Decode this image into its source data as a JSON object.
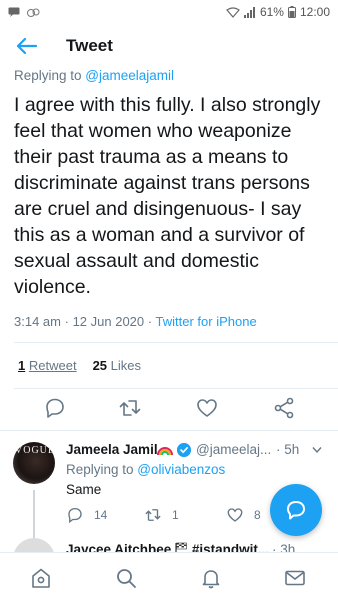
{
  "status": {
    "battery": "61%",
    "time": "12:00"
  },
  "header": {
    "title": "Tweet"
  },
  "tweet": {
    "replying_prefix": "Replying to ",
    "replying_handle": "@jameelajamil",
    "text": "I agree with this fully. I also strongly feel that women who weaponize their past trauma as a means to discriminate against trans persons are cruel and disingenuous- I say this as a woman and a survivor of sexual assault and domestic violence.",
    "time": "3:14 am",
    "date": "12 Jun 2020",
    "separator": "·",
    "source": "Twitter for iPhone",
    "retweets_count": "1",
    "retweets_label": "Retweet",
    "likes_count": "25",
    "likes_label": "Likes"
  },
  "actions": [
    "reply-icon",
    "retweet-icon",
    "like-icon",
    "share-icon"
  ],
  "reply": {
    "avatar_text": "VOGUE",
    "name": "Jameela Jamil",
    "handle": "@jameelaj...",
    "dot": "·",
    "time": "5h",
    "replying_prefix": "Replying to ",
    "replying_handle": "@oliviabenzos",
    "text": "Same",
    "reply_count": "14",
    "retweet_count": "1",
    "like_count": "8"
  },
  "next_reply": {
    "name": "Jaycee Aitchbee",
    "hashtag": "#istandwit...",
    "time": "3h"
  },
  "colors": {
    "accent": "#1da1f2",
    "text": "#14171a",
    "muted": "#657786"
  }
}
